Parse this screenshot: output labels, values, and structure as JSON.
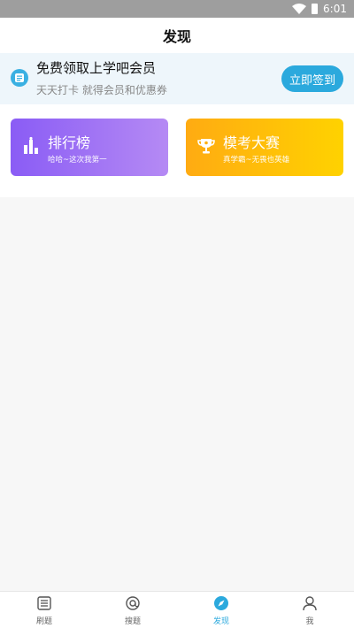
{
  "status_bar": {
    "time": "6:01"
  },
  "header": {
    "title": "发现"
  },
  "banner": {
    "title": "免费领取上学吧会员",
    "subtitle": "天天打卡 就得会员和优惠券",
    "button_label": "立即签到"
  },
  "cards": [
    {
      "title": "排行榜",
      "subtitle": "哈哈~这次我第一"
    },
    {
      "title": "模考大赛",
      "subtitle": "真学霸~无畏也英雄"
    }
  ],
  "tabs": [
    {
      "label": "刷题",
      "icon": "list-icon",
      "active": false
    },
    {
      "label": "搜题",
      "icon": "at-search-icon",
      "active": false
    },
    {
      "label": "发现",
      "icon": "compass-icon",
      "active": true
    },
    {
      "label": "我",
      "icon": "person-icon",
      "active": false
    }
  ],
  "colors": {
    "accent": "#2ba9dd",
    "rank_gradient": [
      "#8a5cf5",
      "#b58af4"
    ],
    "exam_gradient": [
      "#ffab12",
      "#ffd200"
    ]
  }
}
